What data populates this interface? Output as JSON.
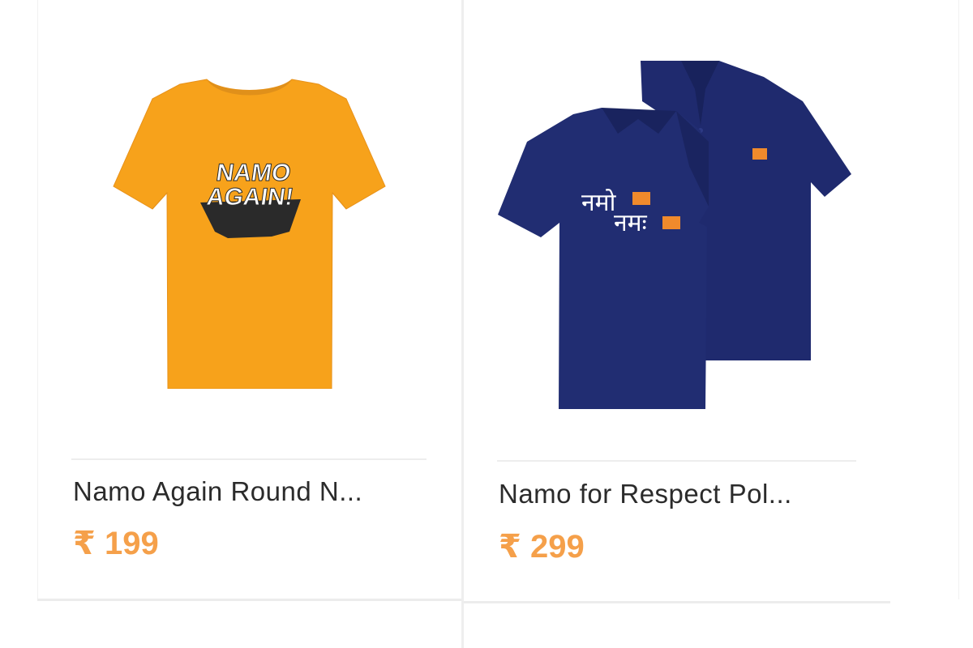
{
  "products": [
    {
      "name": "Namo Again Round N...",
      "price": "₹ 199",
      "print_text_1": "NAMO",
      "print_text_2": "AGAIN!",
      "shirt_color": "#f7a21b"
    },
    {
      "name": "Namo for Respect Pol...",
      "price": "₹ 299",
      "print_text_1": "नमो",
      "print_text_2": "नमः",
      "shirt_color": "#1f2a6e"
    }
  ],
  "colors": {
    "price_accent": "#f5a04a",
    "print_accent": "#f08a2c"
  }
}
